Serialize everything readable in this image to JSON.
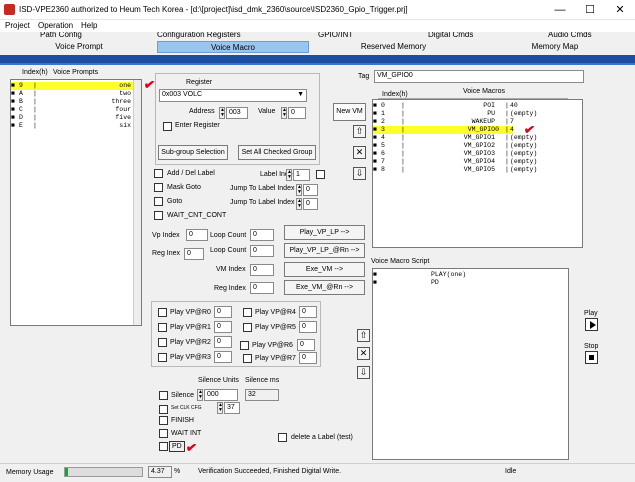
{
  "window": {
    "title": "ISD-VPE2360 authorized to Heum Tech Korea - [d:\\[project]\\isd_dmk_2360\\source\\ISD2360_Gpio_Trigger.prj]",
    "minimize": "—",
    "maximize": "☐",
    "close": "✕"
  },
  "menu": [
    "Project",
    "Operation",
    "Help"
  ],
  "tabs_top": [
    "Path Config",
    "Configuration Registers",
    "GPIO/INT",
    "Digital Cmds",
    "Audio Cmds"
  ],
  "tabs_bottom": [
    "Voice Prompt",
    "Voice Macro",
    "Reserved Memory",
    "Memory Map"
  ],
  "prompts": {
    "header_index": "Index(h)",
    "header_name": "Voice Prompts",
    "rows": [
      {
        "idx": "9",
        "name": "one"
      },
      {
        "idx": "A",
        "name": "two"
      },
      {
        "idx": "B",
        "name": "three"
      },
      {
        "idx": "C",
        "name": "four"
      },
      {
        "idx": "D",
        "name": "five"
      },
      {
        "idx": "E",
        "name": "six"
      }
    ]
  },
  "register": {
    "label": "Register",
    "value": "0x003 VOLC",
    "address_label": "Address",
    "address_value": "003",
    "value_label": "Value",
    "value_value": "0",
    "enter_label": "Enter Register",
    "subgroup_btn": "Sub-group Selection",
    "setall_btn": "Set All Checked Group"
  },
  "options": {
    "add_del": "Add / Del Label",
    "label_index": "Label Index",
    "label_index_val": "1",
    "mask_goto": "Mask Goto",
    "jump1": "Jump To Label Index",
    "jump1_val": "0",
    "goto": "Goto",
    "jump2": "Jump To Label Index",
    "jump2_val": "0",
    "wait_cnt": "WAIT_CNT_CONT"
  },
  "play": {
    "vp_index": "Vp Index",
    "vp_index_val": "0",
    "loop1": "Loop Count",
    "loop1_val": "0",
    "play_vp_lp": "Play_VP_LP -->",
    "reg_inex": "Reg Inex",
    "reg_inex_val": "0",
    "loop2": "Loop Count",
    "loop2_val": "0",
    "play_vp_lp_rn": "Play_VP_LP_@Rn -->",
    "vm_index": "VM Index",
    "vm_index_val": "0",
    "exe_vm": "Exe_VM -->",
    "reg_index": "Reg Index",
    "reg_index_val": "0",
    "exe_vm_rn": "Exe_VM_@Rn -->"
  },
  "play_regs": [
    {
      "label": "Play VP@R0",
      "val": "0"
    },
    {
      "label": "Play VP@R4",
      "val": "0"
    },
    {
      "label": "Play VP@R1",
      "val": "0"
    },
    {
      "label": "Play VP@R5",
      "val": "0"
    },
    {
      "label": "Play VP@R2",
      "val": "0"
    },
    {
      "label": "Play VP@R6",
      "val": "0"
    },
    {
      "label": "Play VP@R3",
      "val": "0"
    },
    {
      "label": "Play VP@R7",
      "val": "0"
    }
  ],
  "silence": {
    "units_label": "Silence Units",
    "ms_label": "Silence ms",
    "silence": "Silence",
    "units_val": "000",
    "ms_val": "32",
    "set_clk": "Set CLK CFG",
    "clk_val": "37",
    "finish": "FINISH",
    "wait_int": "WAIT INT",
    "pd": "PD",
    "delete_label": "delete a Label (test)"
  },
  "macro": {
    "tag_label": "Tag",
    "tag_value": "VM_GPIO0",
    "new_vm": "New VM",
    "header_index": "Index(h)",
    "header_name": "Voice Macros",
    "rows": [
      {
        "idx": "0",
        "name": "POI",
        "info": "40"
      },
      {
        "idx": "1",
        "name": "PU",
        "info": "(empty)"
      },
      {
        "idx": "2",
        "name": "WAKEUP",
        "info": "7"
      },
      {
        "idx": "3",
        "name": "VM_GPIO0",
        "info": "4"
      },
      {
        "idx": "4",
        "name": "VM_GPIO1",
        "info": "(empty)"
      },
      {
        "idx": "5",
        "name": "VM_GPIO2",
        "info": "(empty)"
      },
      {
        "idx": "6",
        "name": "VM_GPIO3",
        "info": "(empty)"
      },
      {
        "idx": "7",
        "name": "VM_GPIO4",
        "info": "(empty)"
      },
      {
        "idx": "8",
        "name": "VM_GPIO5",
        "info": "(empty)"
      }
    ]
  },
  "script": {
    "label": "Voice Macro Script",
    "lines": [
      "PLAY(one)",
      "PD"
    ]
  },
  "controls": {
    "play": "Play",
    "stop": "Stop",
    "up": "⇧",
    "del": "✕",
    "down": "⇩"
  },
  "status": {
    "memory_label": "Memory Usage",
    "memory_pct": "4.37",
    "pct_sign": "%",
    "message": "Verification Succeeded, Finished Digital Write.",
    "state": "Idle",
    "memory_fraction": 0.0437
  }
}
